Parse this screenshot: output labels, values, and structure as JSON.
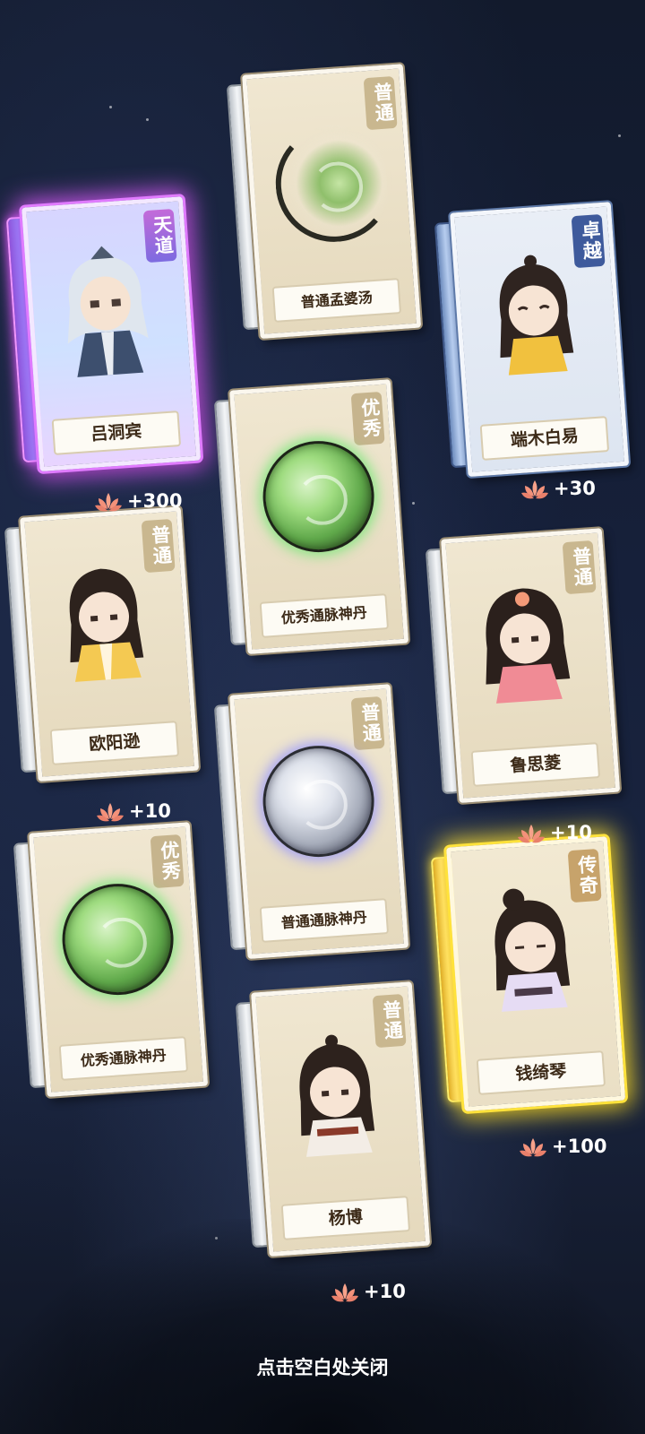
{
  "cards": [
    {
      "id": "mengpo",
      "rarity": "普通",
      "name": "普通孟婆汤",
      "kind": "item"
    },
    {
      "id": "lvdongbin",
      "rarity": "天道",
      "name": "吕洞宾",
      "kind": "character",
      "reward": "+300"
    },
    {
      "id": "duanmu",
      "rarity": "卓越",
      "name": "端木白易",
      "kind": "character",
      "reward": "+30"
    },
    {
      "id": "youxiu1",
      "rarity": "优秀",
      "name": "优秀通脉神丹",
      "kind": "item"
    },
    {
      "id": "ouyang",
      "rarity": "普通",
      "name": "欧阳逊",
      "kind": "character",
      "reward": "+10"
    },
    {
      "id": "lusiling",
      "rarity": "普通",
      "name": "鲁思菱",
      "kind": "character",
      "reward": "+10"
    },
    {
      "id": "putong_dan",
      "rarity": "普通",
      "name": "普通通脉神丹",
      "kind": "item"
    },
    {
      "id": "youxiu2",
      "rarity": "优秀",
      "name": "优秀通脉神丹",
      "kind": "item"
    },
    {
      "id": "qianqiqin",
      "rarity": "传奇",
      "name": "钱绮琴",
      "kind": "character",
      "reward": "+100"
    },
    {
      "id": "yangbo",
      "rarity": "普通",
      "name": "杨博",
      "kind": "character",
      "reward": "+10"
    }
  ],
  "close_hint": "点击空白处关闭",
  "icons": {
    "reward": "lotus-icon"
  },
  "colors": {
    "legendary_glow": "#ffe23b",
    "heavenly_glow": "#e07bff",
    "excellent_blue": "#3e5a9c"
  }
}
